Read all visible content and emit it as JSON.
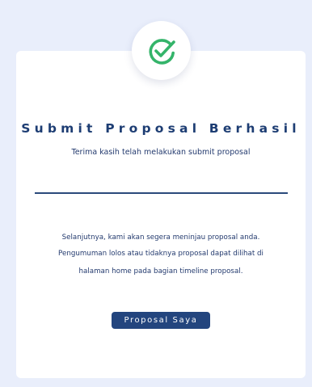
{
  "status": {
    "icon": "check-circle-icon",
    "accent_color": "#34b46a",
    "title": "Submit Proposal Berhasil",
    "subtitle": "Terima kasih telah melakukan submit proposal"
  },
  "message": {
    "lines": [
      "Selanjutnya, kami akan segera meninjau proposal anda.",
      "Pengumuman lolos atau tidaknya proposal dapat dilihat di",
      "halaman home pada bagian timeline proposal."
    ]
  },
  "actions": {
    "primary_label": "Proposal Saya",
    "primary_color": "#23457e"
  }
}
